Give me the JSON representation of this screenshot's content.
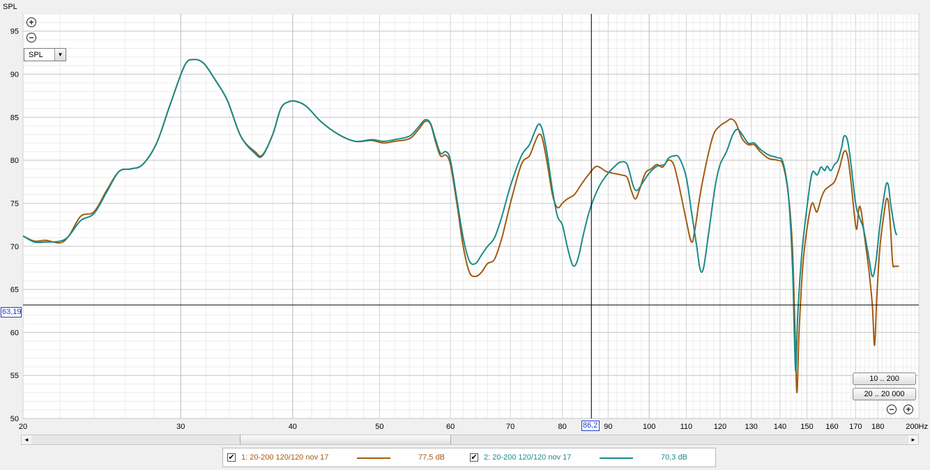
{
  "toolbar": {
    "ylabel": "SPL",
    "zoom_in_symbol": "+",
    "zoom_out_symbol": "−",
    "select_value": "SPL",
    "select_arrow": "▼"
  },
  "cursor": {
    "y_readout": "63,19",
    "x_readout": "86,2",
    "y_value": 63.19,
    "x_value": 86.2
  },
  "range_buttons": [
    "10 .. 200",
    "20 .. 20 000"
  ],
  "bottom_zoom": {
    "out": "−",
    "in": "+"
  },
  "scrollbar": {
    "left_arrow": "◄",
    "right_arrow": "►",
    "thumb_start_fraction": 0.25,
    "thumb_width_fraction": 0.24
  },
  "legend": [
    {
      "check": "✔",
      "label": "1: 20-200 120/120 nov 17",
      "value": "77,5 dB",
      "color": "#a35a10"
    },
    {
      "check": "✔",
      "label": "2: 20-200 120/120 nov 17",
      "value": "70,3 dB",
      "color": "#1a8a88"
    }
  ],
  "chart_data": {
    "type": "line",
    "title": "",
    "xlabel": "Hz",
    "ylabel": "SPL",
    "xscale": "log",
    "xlim": [
      20,
      200
    ],
    "ylim": [
      50,
      97
    ],
    "grid": true,
    "x_ticks": [
      20,
      30,
      40,
      50,
      60,
      70,
      80,
      90,
      100,
      110,
      120,
      130,
      140,
      150,
      160,
      170,
      180,
      200
    ],
    "x_tick_labels": [
      "20",
      "30",
      "40",
      "50",
      "60",
      "70",
      "80",
      "90",
      "100",
      "110",
      "120",
      "130",
      "140",
      "150",
      "160",
      "170",
      "180",
      "200Hz"
    ],
    "y_ticks": [
      50,
      55,
      60,
      65,
      70,
      75,
      80,
      85,
      90,
      95
    ],
    "series": [
      {
        "name": "1: 20-200 120/120 nov 17",
        "color": "#a35a10",
        "points": [
          [
            20,
            71.2
          ],
          [
            20.6,
            70.6
          ],
          [
            21.2,
            70.7
          ],
          [
            22,
            70.4
          ],
          [
            22.5,
            71.2
          ],
          [
            23.2,
            73.5
          ],
          [
            24,
            74.0
          ],
          [
            24.8,
            76.5
          ],
          [
            25.6,
            78.7
          ],
          [
            26.4,
            79.0
          ],
          [
            27.2,
            79.5
          ],
          [
            28.2,
            82.0
          ],
          [
            29.2,
            86.5
          ],
          [
            30.3,
            91.0
          ],
          [
            31.0,
            91.7
          ],
          [
            31.8,
            91.3
          ],
          [
            32.7,
            89.5
          ],
          [
            33.8,
            87.0
          ],
          [
            35.0,
            82.8
          ],
          [
            36.3,
            81.0
          ],
          [
            37.0,
            80.6
          ],
          [
            38.0,
            83.0
          ],
          [
            38.8,
            86.0
          ],
          [
            39.6,
            86.8
          ],
          [
            40.5,
            86.8
          ],
          [
            41.5,
            86.2
          ],
          [
            43.0,
            84.5
          ],
          [
            45.0,
            83.0
          ],
          [
            47.0,
            82.2
          ],
          [
            49.0,
            82.3
          ],
          [
            50.5,
            82.0
          ],
          [
            52.0,
            82.2
          ],
          [
            54.0,
            82.5
          ],
          [
            55.2,
            83.5
          ],
          [
            56.2,
            84.5
          ],
          [
            57.0,
            84.2
          ],
          [
            57.8,
            82.0
          ],
          [
            58.5,
            80.5
          ],
          [
            59.3,
            80.6
          ],
          [
            60.0,
            79.5
          ],
          [
            61.0,
            75.0
          ],
          [
            62.0,
            70.0
          ],
          [
            63.0,
            67.0
          ],
          [
            64.0,
            66.5
          ],
          [
            65.0,
            67.0
          ],
          [
            66.0,
            68.0
          ],
          [
            67.2,
            68.5
          ],
          [
            68.5,
            71.0
          ],
          [
            70.0,
            75.0
          ],
          [
            72.0,
            79.5
          ],
          [
            73.5,
            80.5
          ],
          [
            74.5,
            82.0
          ],
          [
            75.3,
            83.0
          ],
          [
            76.0,
            82.5
          ],
          [
            77.0,
            79.5
          ],
          [
            78.0,
            76.0
          ],
          [
            79.0,
            74.5
          ],
          [
            80.0,
            75.0
          ],
          [
            81.0,
            75.5
          ],
          [
            82.5,
            76.0
          ],
          [
            84.0,
            77.2
          ],
          [
            85.5,
            78.3
          ],
          [
            87.0,
            79.2
          ],
          [
            88.0,
            79.2
          ],
          [
            89.5,
            78.7
          ],
          [
            91.0,
            78.5
          ],
          [
            93.0,
            78.3
          ],
          [
            94.5,
            78.0
          ],
          [
            95.5,
            76.5
          ],
          [
            96.5,
            75.5
          ],
          [
            97.5,
            76.5
          ],
          [
            99.0,
            78.5
          ],
          [
            100.5,
            79.0
          ],
          [
            102.0,
            79.5
          ],
          [
            103.5,
            79.2
          ],
          [
            105.0,
            80.0
          ],
          [
            106.5,
            79.5
          ],
          [
            108.0,
            77.0
          ],
          [
            110.0,
            73.0
          ],
          [
            111.5,
            70.5
          ],
          [
            112.5,
            72.0
          ],
          [
            114.0,
            76.0
          ],
          [
            116.0,
            80.0
          ],
          [
            118.0,
            83.0
          ],
          [
            120.0,
            84.0
          ],
          [
            122.0,
            84.5
          ],
          [
            123.5,
            84.8
          ],
          [
            125.0,
            84.3
          ],
          [
            127.0,
            82.5
          ],
          [
            129.0,
            81.8
          ],
          [
            131.0,
            81.8
          ],
          [
            133.0,
            81.0
          ],
          [
            136.0,
            80.2
          ],
          [
            139.0,
            80.0
          ],
          [
            141.0,
            79.5
          ],
          [
            143.0,
            76.0
          ],
          [
            144.5,
            70.0
          ],
          [
            145.5,
            60.0
          ],
          [
            146.2,
            53.0
          ],
          [
            147.0,
            60.0
          ],
          [
            148.5,
            68.0
          ],
          [
            150.5,
            73.0
          ],
          [
            152.0,
            75.0
          ],
          [
            153.0,
            74.5
          ],
          [
            154.0,
            74.0
          ],
          [
            155.5,
            75.5
          ],
          [
            157.0,
            76.5
          ],
          [
            159.0,
            77.0
          ],
          [
            161.0,
            77.5
          ],
          [
            163.0,
            79.0
          ],
          [
            165.0,
            81.0
          ],
          [
            166.5,
            80.5
          ],
          [
            168.0,
            77.5
          ],
          [
            169.5,
            73.5
          ],
          [
            170.5,
            72.0
          ],
          [
            171.5,
            74.5
          ],
          [
            172.5,
            74.0
          ],
          [
            174.0,
            71.0
          ],
          [
            176.0,
            67.0
          ],
          [
            177.5,
            63.0
          ],
          [
            178.5,
            58.5
          ],
          [
            179.5,
            64.0
          ],
          [
            181.0,
            70.0
          ],
          [
            183.0,
            74.0
          ],
          [
            184.0,
            75.5
          ],
          [
            185.0,
            75.0
          ],
          [
            186.0,
            72.0
          ],
          [
            187.0,
            68.0
          ],
          [
            188.0,
            67.7
          ],
          [
            190.0,
            67.7
          ]
        ]
      },
      {
        "name": "2: 20-200 120/120 nov 17",
        "color": "#1a8a88",
        "points": [
          [
            20,
            71.2
          ],
          [
            20.6,
            70.5
          ],
          [
            21.2,
            70.5
          ],
          [
            22,
            70.6
          ],
          [
            22.5,
            71.2
          ],
          [
            23.2,
            73.0
          ],
          [
            24,
            73.8
          ],
          [
            24.8,
            76.3
          ],
          [
            25.6,
            78.7
          ],
          [
            26.4,
            79.0
          ],
          [
            27.2,
            79.5
          ],
          [
            28.2,
            82.0
          ],
          [
            29.2,
            86.5
          ],
          [
            30.3,
            91.0
          ],
          [
            31.0,
            91.7
          ],
          [
            31.8,
            91.3
          ],
          [
            32.7,
            89.5
          ],
          [
            33.8,
            87.0
          ],
          [
            35.0,
            82.8
          ],
          [
            36.3,
            80.8
          ],
          [
            37.0,
            80.5
          ],
          [
            38.0,
            83.0
          ],
          [
            38.8,
            86.0
          ],
          [
            39.6,
            86.8
          ],
          [
            40.5,
            86.8
          ],
          [
            41.5,
            86.2
          ],
          [
            43.0,
            84.5
          ],
          [
            45.0,
            83.0
          ],
          [
            47.0,
            82.2
          ],
          [
            49.0,
            82.4
          ],
          [
            50.5,
            82.2
          ],
          [
            52.0,
            82.4
          ],
          [
            54.0,
            82.8
          ],
          [
            55.2,
            83.8
          ],
          [
            56.2,
            84.7
          ],
          [
            57.0,
            84.3
          ],
          [
            57.8,
            82.3
          ],
          [
            58.5,
            80.8
          ],
          [
            59.3,
            81.0
          ],
          [
            60.0,
            80.0
          ],
          [
            61.0,
            75.5
          ],
          [
            62.0,
            71.0
          ],
          [
            63.0,
            68.3
          ],
          [
            64.0,
            68.0
          ],
          [
            65.0,
            69.0
          ],
          [
            66.0,
            70.0
          ],
          [
            67.2,
            71.0
          ],
          [
            68.5,
            73.5
          ],
          [
            70.0,
            77.0
          ],
          [
            72.0,
            80.5
          ],
          [
            73.5,
            81.8
          ],
          [
            74.5,
            83.3
          ],
          [
            75.3,
            84.2
          ],
          [
            76.0,
            83.5
          ],
          [
            77.0,
            80.5
          ],
          [
            78.0,
            76.5
          ],
          [
            79.0,
            73.5
          ],
          [
            80.0,
            72.5
          ],
          [
            81.0,
            70.0
          ],
          [
            82.0,
            68.0
          ],
          [
            82.7,
            67.8
          ],
          [
            83.5,
            69.0
          ],
          [
            84.5,
            71.5
          ],
          [
            86.0,
            74.5
          ],
          [
            88.0,
            77.0
          ],
          [
            90.0,
            78.5
          ],
          [
            92.0,
            79.5
          ],
          [
            93.0,
            79.8
          ],
          [
            94.5,
            79.5
          ],
          [
            96.0,
            77.0
          ],
          [
            97.0,
            76.5
          ],
          [
            98.5,
            77.5
          ],
          [
            100.0,
            78.5
          ],
          [
            102.0,
            79.3
          ],
          [
            104.0,
            79.5
          ],
          [
            105.0,
            80.2
          ],
          [
            106.5,
            80.5
          ],
          [
            108.0,
            80.3
          ],
          [
            110.0,
            78.0
          ],
          [
            111.5,
            74.0
          ],
          [
            113.0,
            70.0
          ],
          [
            114.0,
            67.3
          ],
          [
            115.0,
            67.5
          ],
          [
            116.5,
            71.5
          ],
          [
            118.5,
            77.0
          ],
          [
            120.0,
            79.5
          ],
          [
            122.0,
            81.0
          ],
          [
            124.0,
            83.0
          ],
          [
            125.5,
            83.6
          ],
          [
            127.0,
            83.0
          ],
          [
            129.0,
            82.0
          ],
          [
            131.0,
            82.0
          ],
          [
            133.0,
            81.3
          ],
          [
            136.0,
            80.6
          ],
          [
            139.0,
            80.3
          ],
          [
            141.0,
            79.8
          ],
          [
            143.0,
            76.0
          ],
          [
            144.5,
            68.0
          ],
          [
            145.2,
            60.0
          ],
          [
            145.8,
            55.5
          ],
          [
            146.5,
            62.0
          ],
          [
            148.0,
            69.0
          ],
          [
            150.0,
            74.5
          ],
          [
            152.0,
            78.5
          ],
          [
            154.0,
            78.3
          ],
          [
            155.5,
            79.2
          ],
          [
            157.0,
            78.8
          ],
          [
            158.0,
            79.3
          ],
          [
            159.5,
            78.8
          ],
          [
            161.0,
            79.5
          ],
          [
            162.5,
            80.0
          ],
          [
            164.0,
            81.5
          ],
          [
            165.0,
            82.8
          ],
          [
            166.5,
            82.3
          ],
          [
            168.0,
            79.5
          ],
          [
            170.0,
            75.0
          ],
          [
            171.5,
            73.5
          ],
          [
            173.5,
            72.0
          ],
          [
            176.0,
            68.5
          ],
          [
            177.5,
            66.5
          ],
          [
            179.0,
            68.0
          ],
          [
            181.0,
            72.5
          ],
          [
            183.0,
            76.0
          ],
          [
            184.0,
            77.3
          ],
          [
            185.0,
            77.0
          ],
          [
            186.0,
            75.0
          ],
          [
            188.0,
            72.0
          ],
          [
            189.0,
            71.3
          ]
        ]
      }
    ]
  }
}
